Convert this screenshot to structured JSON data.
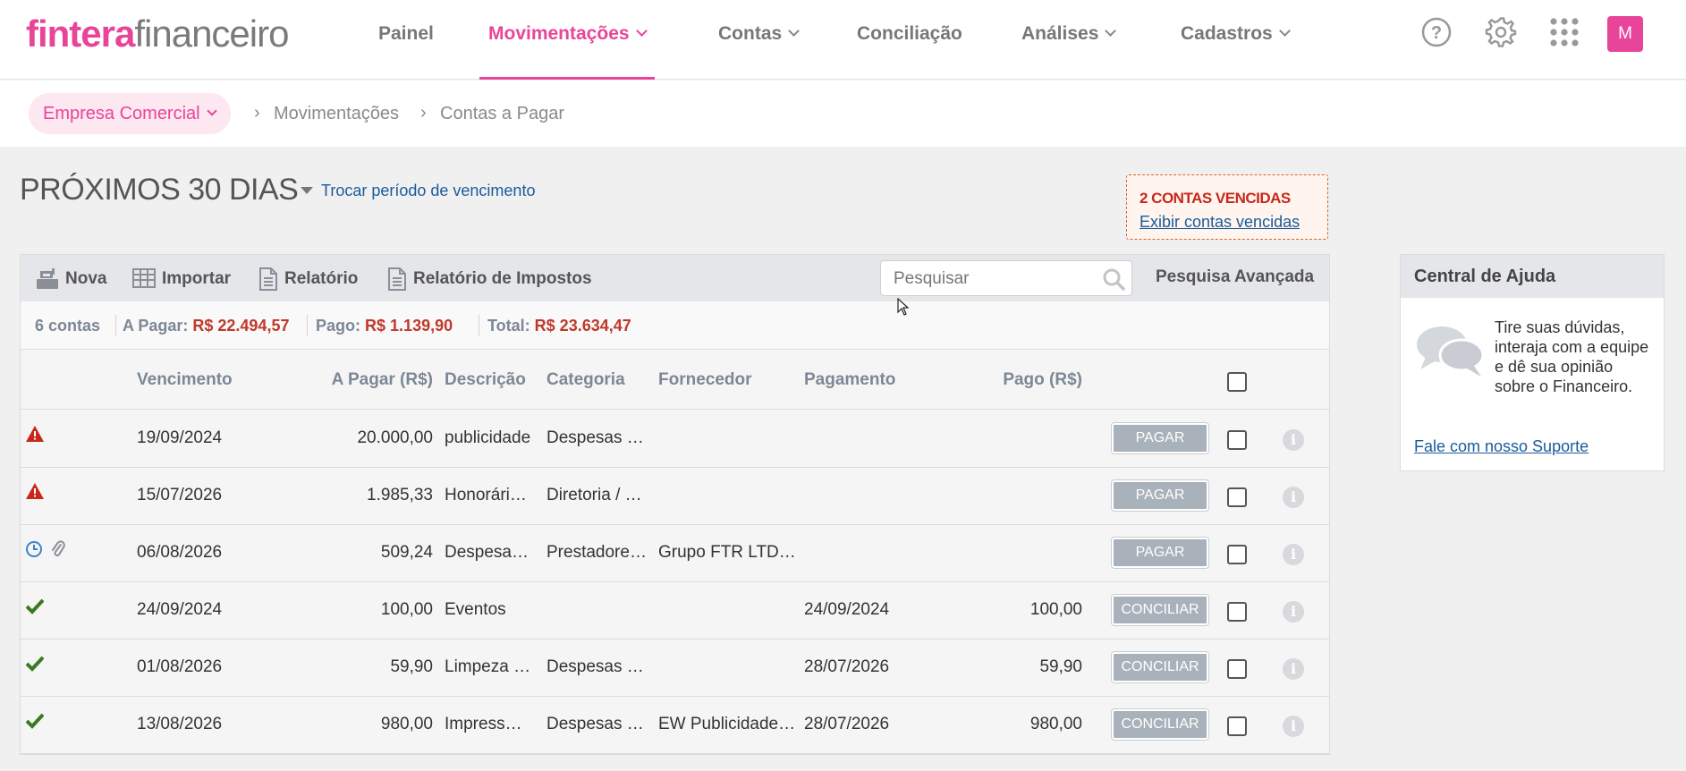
{
  "brand": {
    "part1": "fintera",
    "part2": "financeiro"
  },
  "nav": [
    {
      "label": "Painel",
      "dropdown": false,
      "active": false
    },
    {
      "label": "Movimentações",
      "dropdown": true,
      "active": true
    },
    {
      "label": "Contas",
      "dropdown": true,
      "active": false
    },
    {
      "label": "Conciliação",
      "dropdown": false,
      "active": false
    },
    {
      "label": "Análises",
      "dropdown": true,
      "active": false
    },
    {
      "label": "Cadastros",
      "dropdown": true,
      "active": false
    }
  ],
  "user": {
    "initial": "M"
  },
  "breadcrumb": {
    "company": "Empresa Comercial",
    "items": [
      "Movimentações",
      "Contas a Pagar"
    ]
  },
  "period": {
    "title": "PRÓXIMOS 30 DIAS",
    "change_link": "Trocar período de vencimento"
  },
  "overdue": {
    "title": "2 CONTAS VENCIDAS",
    "link": "Exibir contas vencidas"
  },
  "toolbar": {
    "nova": "Nova",
    "importar": "Importar",
    "relatorio": "Relatório",
    "relatorio_impostos": "Relatório de Impostos",
    "search_placeholder": "Pesquisar",
    "advanced_search": "Pesquisa Avançada"
  },
  "summary": {
    "count": "6 contas",
    "a_pagar_label": "A Pagar:",
    "a_pagar_value": "R$ 22.494,57",
    "pago_label": "Pago:",
    "pago_value": "R$ 1.139,90",
    "total_label": "Total:",
    "total_value": "R$ 23.634,47"
  },
  "table": {
    "headers": {
      "vencimento": "Vencimento",
      "a_pagar": "A Pagar (R$)",
      "descricao": "Descrição",
      "categoria": "Categoria",
      "fornecedor": "Fornecedor",
      "pagamento": "Pagamento",
      "pago": "Pago (R$)"
    },
    "rows": [
      {
        "status": "warning-icon",
        "vencimento": "19/09/2024",
        "a_pagar": "20.000,00",
        "descricao": "publicidade",
        "categoria": "Despesas …",
        "fornecedor": "",
        "pagamento": "",
        "pago": "",
        "action": "PAGAR"
      },
      {
        "status": "warning-icon",
        "vencimento": "15/07/2026",
        "a_pagar": "1.985,33",
        "descricao": "Honorári…",
        "categoria": "Diretoria / …",
        "fornecedor": "",
        "pagamento": "",
        "pago": "",
        "action": "PAGAR"
      },
      {
        "status": "clock-icon",
        "vencimento": "06/08/2026",
        "a_pagar": "509,24",
        "descricao": "Despesa…",
        "categoria": "Prestadore…",
        "fornecedor": "Grupo FTR LTD…",
        "pagamento": "",
        "pago": "",
        "action": "PAGAR"
      },
      {
        "status": "check-icon",
        "vencimento": "24/09/2024",
        "a_pagar": "100,00",
        "descricao": "Eventos",
        "categoria": "",
        "fornecedor": "",
        "pagamento": "24/09/2024",
        "pago": "100,00",
        "action": "CONCILIAR"
      },
      {
        "status": "check-icon",
        "vencimento": "01/08/2026",
        "a_pagar": "59,90",
        "descricao": "Limpeza …",
        "categoria": "Despesas …",
        "fornecedor": "",
        "pagamento": "28/07/2026",
        "pago": "59,90",
        "action": "CONCILIAR"
      },
      {
        "status": "check-icon",
        "vencimento": "13/08/2026",
        "a_pagar": "980,00",
        "descricao": "Impress…",
        "categoria": "Despesas …",
        "fornecedor": "EW Publicidade…",
        "pagamento": "28/07/2026",
        "pago": "980,00",
        "action": "CONCILIAR"
      }
    ]
  },
  "help": {
    "title": "Central de Ajuda",
    "text": "Tire suas dúvidas, interaja com a equipe e dê sua opinião sobre o Financeiro.",
    "link": "Fale com nosso Suporte"
  },
  "colors": {
    "brand_pink": "#e8459a",
    "value_red": "#c0392b",
    "link_blue": "#1a5b9c",
    "button_gray": "#a9b1bb"
  }
}
